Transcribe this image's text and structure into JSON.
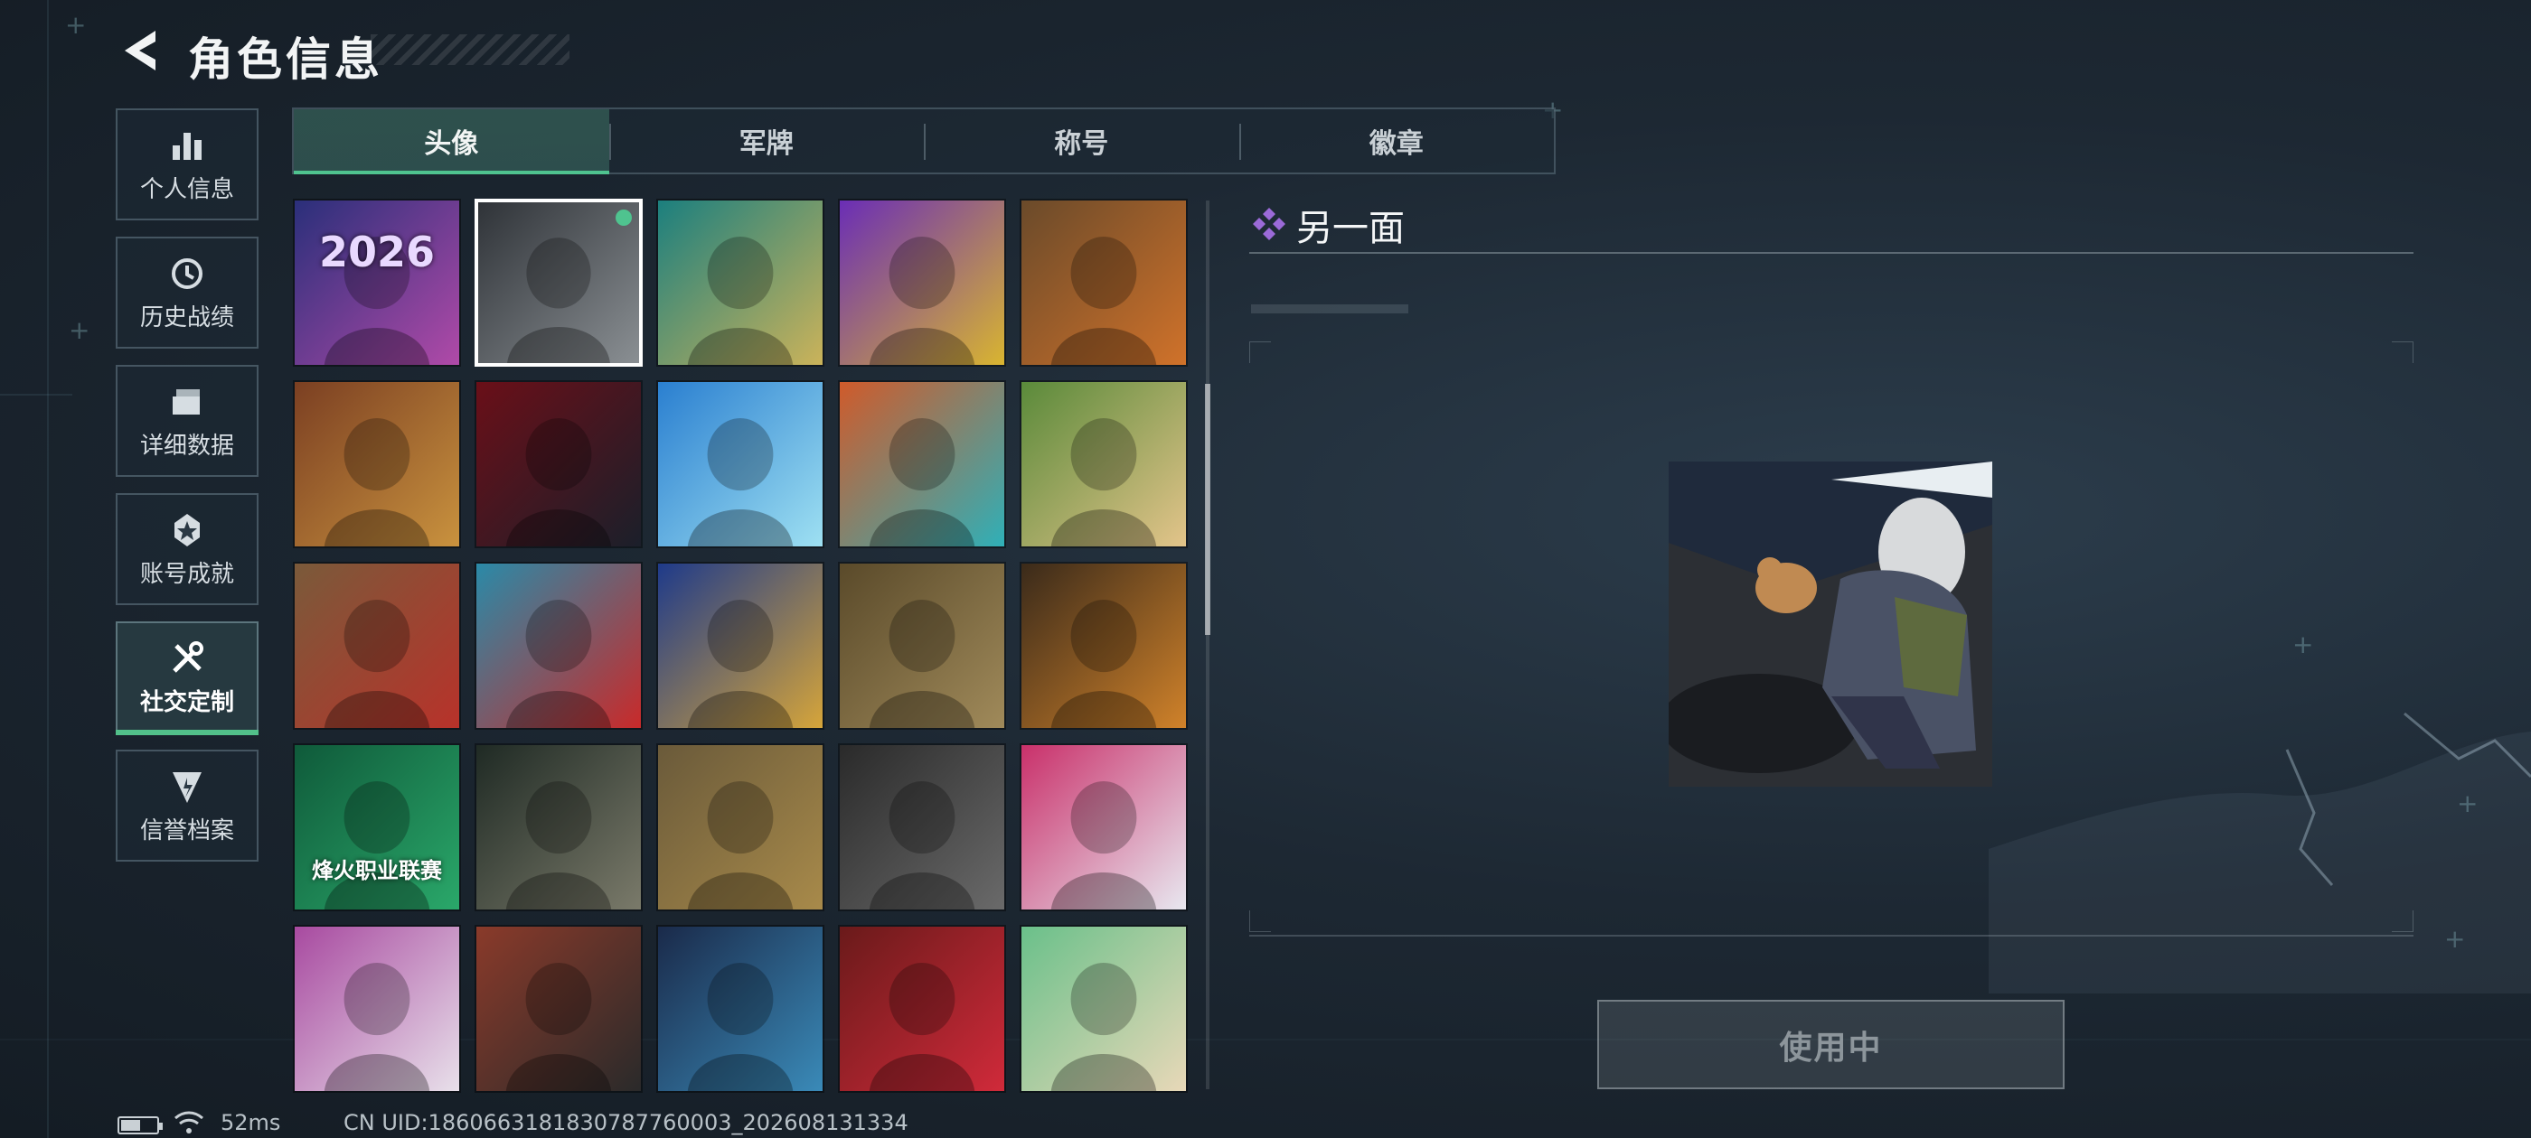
{
  "header": {
    "title": "角色信息",
    "back_icon": "back-arrow-icon"
  },
  "sidebar": {
    "items": [
      {
        "label": "个人信息",
        "icon": "bar-chart-icon",
        "active": false
      },
      {
        "label": "历史战绩",
        "icon": "history-clock-icon",
        "active": false
      },
      {
        "label": "详细数据",
        "icon": "folder-icon",
        "active": false
      },
      {
        "label": "账号成就",
        "icon": "achievement-badge-icon",
        "active": false
      },
      {
        "label": "社交定制",
        "icon": "tools-icon",
        "active": true
      },
      {
        "label": "信誉档案",
        "icon": "credit-shield-icon",
        "active": false
      }
    ]
  },
  "tabs": [
    {
      "label": "头像",
      "active": true
    },
    {
      "label": "军牌",
      "active": false
    },
    {
      "label": "称号",
      "active": false
    },
    {
      "label": "徽章",
      "active": false
    }
  ],
  "avatars": [
    {
      "name": "fireworks-2026",
      "text": "2026",
      "colors": [
        "#2a2f7a",
        "#b04aa8"
      ],
      "selected": false
    },
    {
      "name": "other-side",
      "colors": [
        "#2f3338",
        "#8a8f93"
      ],
      "selected": true
    },
    {
      "name": "blonde-boy",
      "colors": [
        "#1b7f7e",
        "#cbb35a"
      ],
      "selected": false
    },
    {
      "name": "neon-soldier",
      "colors": [
        "#6a2db6",
        "#d9b530"
      ],
      "selected": false
    },
    {
      "name": "bbq-soldier",
      "colors": [
        "#6a4a2a",
        "#d0722a"
      ],
      "selected": false
    },
    {
      "name": "feast-table",
      "colors": [
        "#7b3f22",
        "#c9923e"
      ],
      "selected": false
    },
    {
      "name": "red-hood",
      "colors": [
        "#6a0f18",
        "#1b1f2a"
      ],
      "selected": false
    },
    {
      "name": "sailboat",
      "colors": [
        "#2a7fd0",
        "#9ee0f2"
      ],
      "selected": false
    },
    {
      "name": "colorful-soldier",
      "colors": [
        "#d05a2a",
        "#2fb0b8"
      ],
      "selected": false
    },
    {
      "name": "chibi-eating",
      "colors": [
        "#5a8a3a",
        "#e3c48a"
      ],
      "selected": false
    },
    {
      "name": "red-mask-card",
      "colors": [
        "#7a5a3a",
        "#b8322a"
      ],
      "selected": false
    },
    {
      "name": "red-mask-duo",
      "colors": [
        "#2a8aa8",
        "#c92a2a"
      ],
      "selected": false
    },
    {
      "name": "gem-crest",
      "colors": [
        "#1e3a8a",
        "#d6a53a"
      ],
      "selected": false
    },
    {
      "name": "gunslinger",
      "colors": [
        "#5a4a2a",
        "#a08a5a"
      ],
      "selected": false
    },
    {
      "name": "veteran-fire",
      "colors": [
        "#3a2a1a",
        "#d0822a"
      ],
      "selected": false
    },
    {
      "name": "league-2026",
      "text": "烽火职业联赛",
      "colors": [
        "#0f5a3a",
        "#2aa86a"
      ],
      "selected": false
    },
    {
      "name": "chibi-veteran",
      "colors": [
        "#1f2a24",
        "#7a7a6a"
      ],
      "selected": false
    },
    {
      "name": "trophy-soldier",
      "colors": [
        "#6a5a3a",
        "#a88a4a"
      ],
      "selected": false
    },
    {
      "name": "eagle-emblem",
      "colors": [
        "#2a2a2a",
        "#6a6a6a"
      ],
      "selected": false
    },
    {
      "name": "anime-girl",
      "colors": [
        "#c9306a",
        "#e8e8f0"
      ],
      "selected": false
    },
    {
      "name": "silver-girl",
      "colors": [
        "#a84aa0",
        "#e8e0ea"
      ],
      "selected": false
    },
    {
      "name": "masked-scared",
      "colors": [
        "#8a3a2a",
        "#2a2a2a"
      ],
      "selected": false
    },
    {
      "name": "gamer-room",
      "colors": [
        "#1a2a4a",
        "#3a8ab8"
      ],
      "selected": false
    },
    {
      "name": "roses-skull",
      "colors": [
        "#6a1a1a",
        "#d02a3a"
      ],
      "selected": false
    },
    {
      "name": "duck-helmet",
      "colors": [
        "#6ac08a",
        "#e8d8b8"
      ],
      "selected": false
    }
  ],
  "detail": {
    "name": "另一面",
    "rarity_icon": "purple-diamond-icon",
    "rarity_color": "#9b6ad8",
    "button_label": "使用中"
  },
  "status": {
    "battery_icon": "battery-icon",
    "battery_level": 0.55,
    "wifi_icon": "wifi-icon",
    "ping": "52ms",
    "uid": "CN UID:1860663181830787760003_202608131334"
  },
  "colors": {
    "accent": "#4fc38f"
  }
}
